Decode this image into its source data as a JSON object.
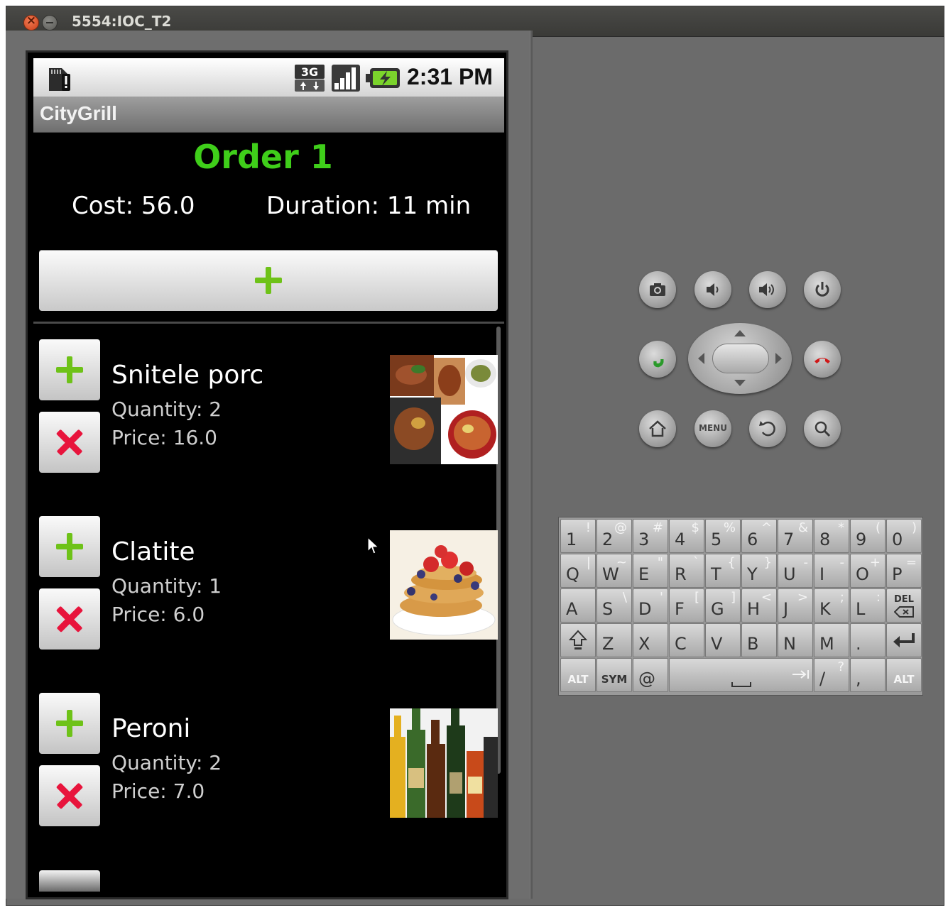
{
  "window": {
    "title": "5554:IOC_T2"
  },
  "status_bar": {
    "time": "2:31 PM",
    "network": "3G"
  },
  "app": {
    "title": "CityGrill"
  },
  "order": {
    "title": "Order 1",
    "cost": "Cost: 56.0",
    "duration": "Duration: 11 min"
  },
  "items": [
    {
      "name": "Snitele porc",
      "quantity": "Quantity: 2",
      "price": "Price: 16.0"
    },
    {
      "name": "Clatite",
      "quantity": "Quantity: 1",
      "price": "Price: 6.0"
    },
    {
      "name": "Peroni",
      "quantity": "Quantity: 2",
      "price": "Price: 7.0"
    }
  ],
  "icons": {
    "add": "plus-icon",
    "remove": "x-icon",
    "camera": "camera-icon",
    "volume_down": "volume-down-icon",
    "volume_up": "volume-up-icon",
    "power": "power-icon",
    "call": "call-icon",
    "end_call": "end-call-icon",
    "home": "home-icon",
    "back": "back-icon",
    "search": "search-icon"
  },
  "controls": {
    "menu_label": "MENU"
  },
  "keyboard": {
    "row1": [
      {
        "main": "1",
        "alt": "!"
      },
      {
        "main": "2",
        "alt": "@"
      },
      {
        "main": "3",
        "alt": "#"
      },
      {
        "main": "4",
        "alt": "$"
      },
      {
        "main": "5",
        "alt": "%"
      },
      {
        "main": "6",
        "alt": "^"
      },
      {
        "main": "7",
        "alt": "&"
      },
      {
        "main": "8",
        "alt": "*"
      },
      {
        "main": "9",
        "alt": "("
      },
      {
        "main": "0",
        "alt": ")"
      }
    ],
    "row2": [
      {
        "main": "Q",
        "alt": "|"
      },
      {
        "main": "W",
        "alt": "~"
      },
      {
        "main": "E",
        "alt": "\""
      },
      {
        "main": "R",
        "alt": "`"
      },
      {
        "main": "T",
        "alt": "{"
      },
      {
        "main": "Y",
        "alt": "}"
      },
      {
        "main": "U",
        "alt": "-"
      },
      {
        "main": "I",
        "alt": "-"
      },
      {
        "main": "O",
        "alt": "+"
      },
      {
        "main": "P",
        "alt": "="
      }
    ],
    "row3": [
      {
        "main": "A",
        "alt": ""
      },
      {
        "main": "S",
        "alt": "\\"
      },
      {
        "main": "D",
        "alt": "'"
      },
      {
        "main": "F",
        "alt": "["
      },
      {
        "main": "G",
        "alt": "]"
      },
      {
        "main": "H",
        "alt": "<"
      },
      {
        "main": "J",
        "alt": ">"
      },
      {
        "main": "K",
        "alt": ";"
      },
      {
        "main": "L",
        "alt": ":"
      }
    ],
    "del_label": "DEL",
    "row4": [
      {
        "main": "Z",
        "alt": ""
      },
      {
        "main": "X",
        "alt": ""
      },
      {
        "main": "C",
        "alt": ""
      },
      {
        "main": "V",
        "alt": ""
      },
      {
        "main": "B",
        "alt": ""
      },
      {
        "main": "N",
        "alt": ""
      },
      {
        "main": "M",
        "alt": ""
      },
      {
        "main": ".",
        "alt": ""
      }
    ],
    "alt_label": "ALT",
    "sym_label": "SYM",
    "at_label": "@",
    "slash": {
      "main": "/",
      "alt": "?"
    },
    "comma": {
      "main": ",",
      "alt": ""
    }
  },
  "colors": {
    "order_title": "#3fce1a",
    "add_icon": "#6ec218",
    "remove_icon": "#e8143c",
    "call_green": "#2a9a2a",
    "end_call_red": "#d01818"
  }
}
